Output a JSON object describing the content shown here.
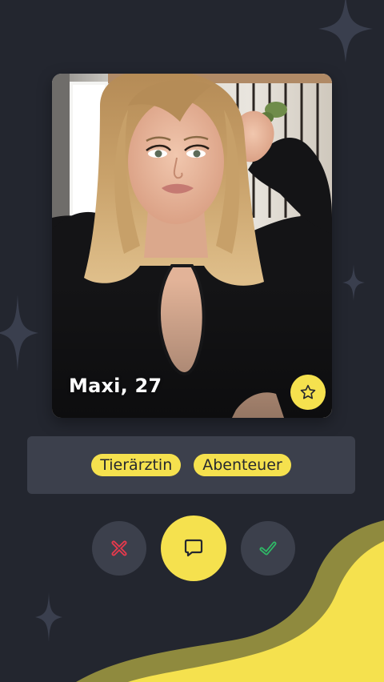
{
  "profile": {
    "name_age": "Maxi, 27",
    "favorite_icon": "star-outline-icon"
  },
  "tags": [
    {
      "label": "Tierärztin"
    },
    {
      "label": "Abenteuer"
    }
  ],
  "actions": {
    "reject_icon": "x-icon",
    "chat_icon": "chat-bubble-icon",
    "accept_icon": "checkmark-icon"
  },
  "colors": {
    "background": "#23262f",
    "panel": "#3c404c",
    "accent_yellow": "#f5e14e",
    "reject_red": "#e8394c",
    "accept_green": "#2fb866",
    "sparkle": "#3a3f4e"
  }
}
